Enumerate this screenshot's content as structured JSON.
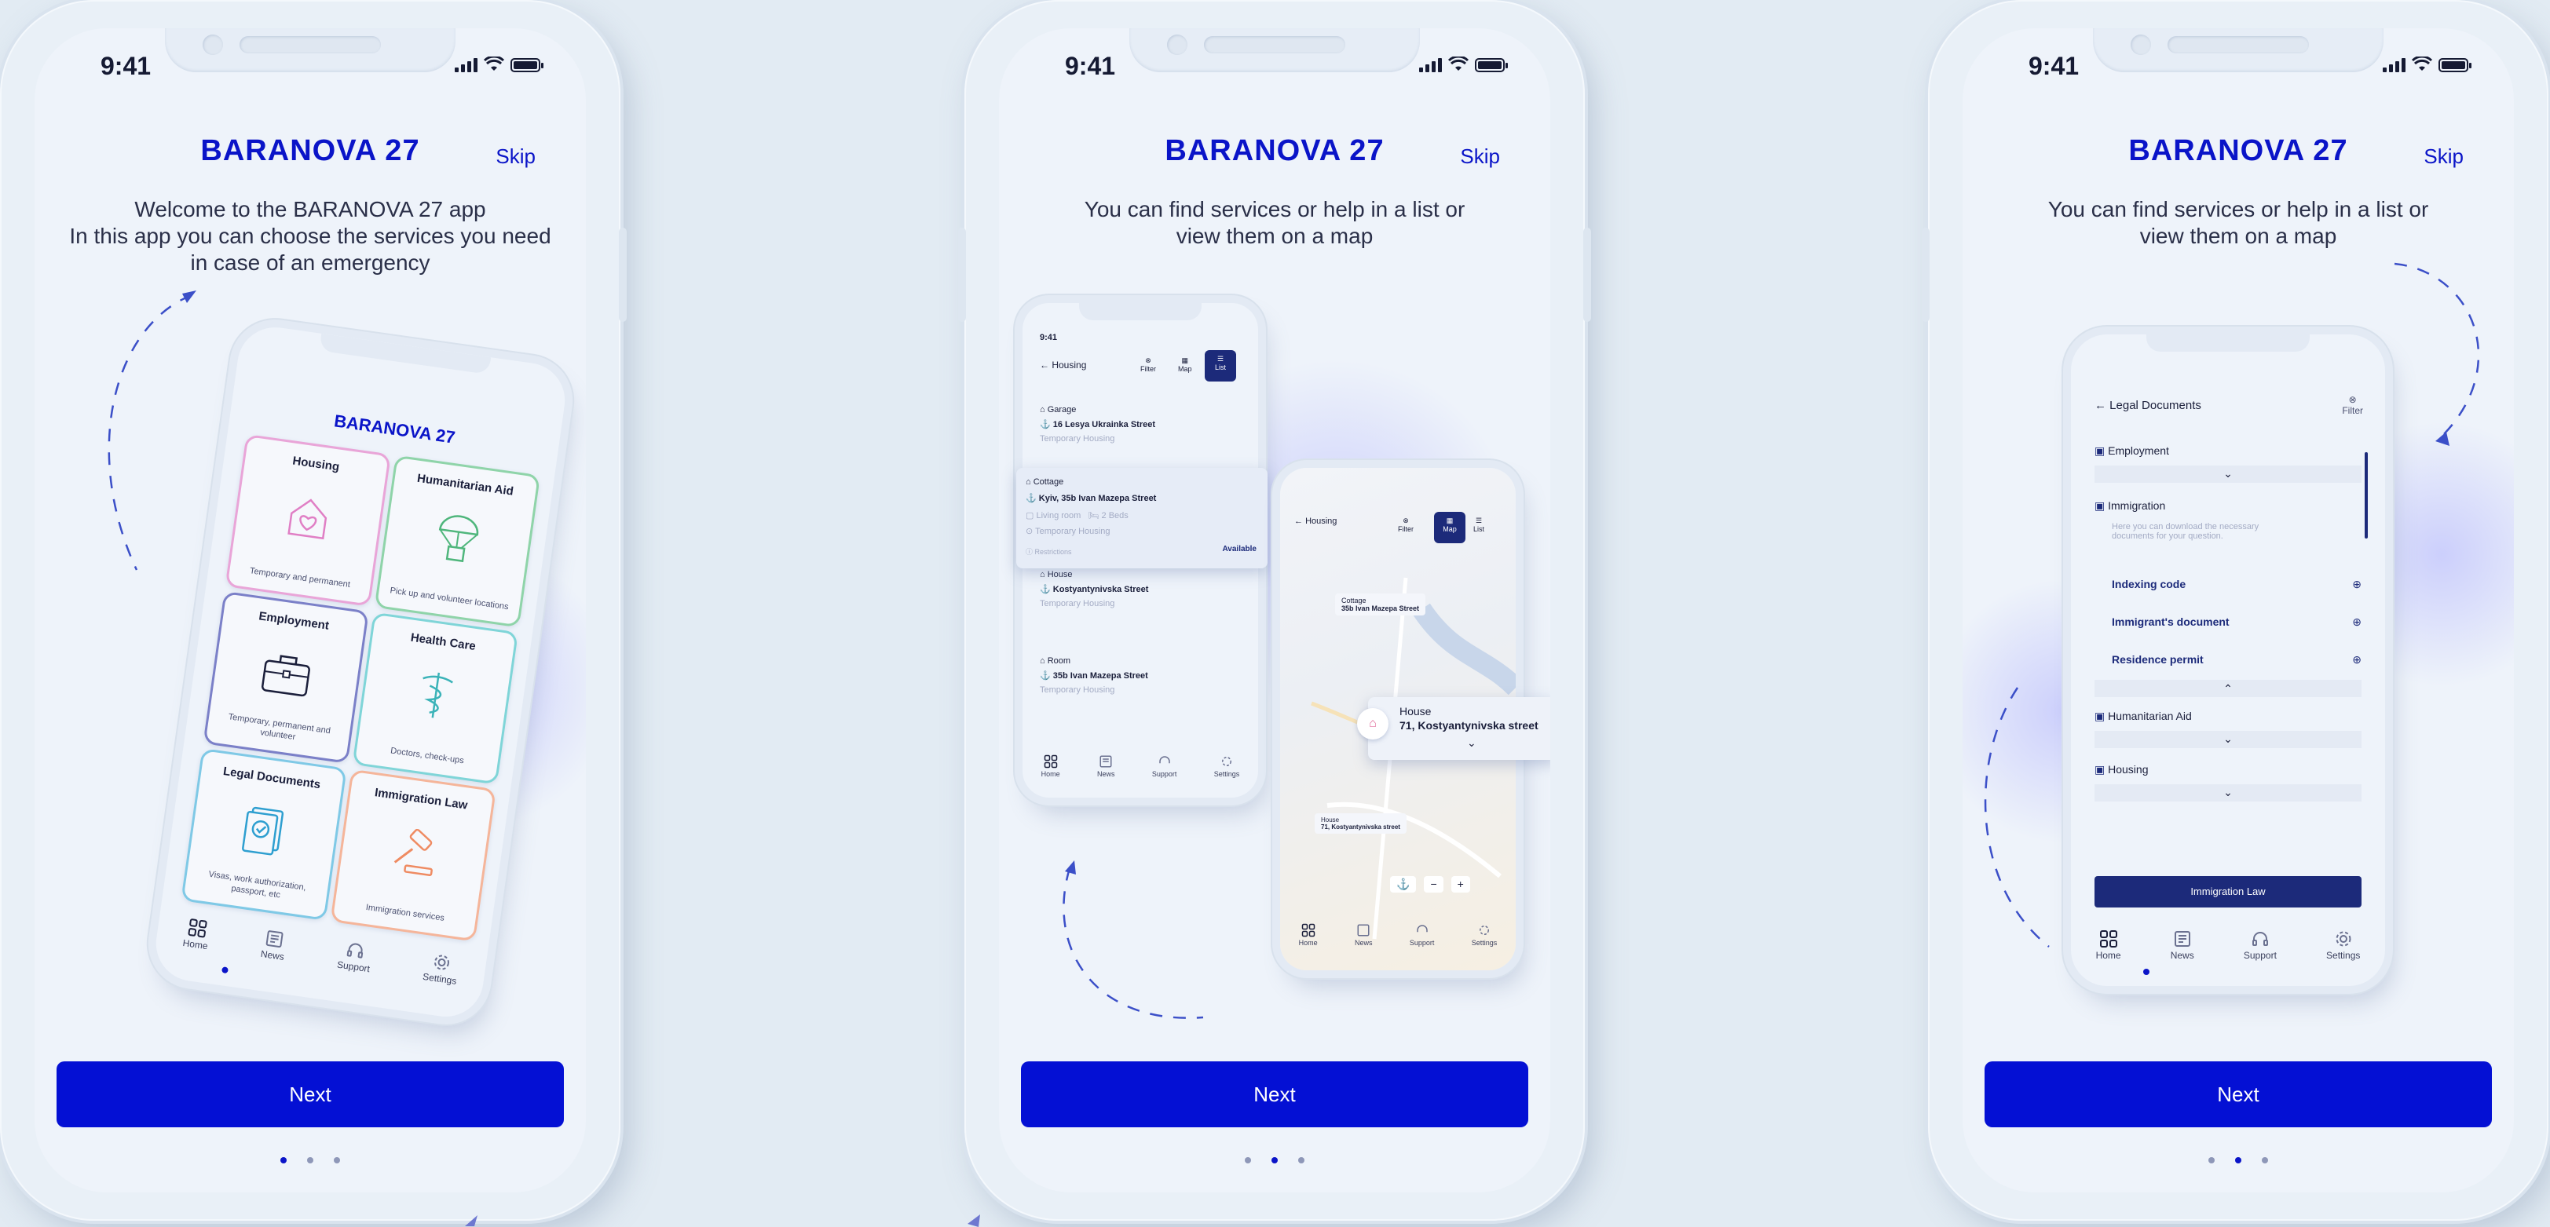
{
  "status": {
    "time": "9:41"
  },
  "screens": [
    {
      "title": "BARANOVA 27",
      "skip": "Skip",
      "desc_lines": [
        "Welcome to the BARANOVA 27 app",
        "In this app you can choose the services you need",
        "in case of an emergency"
      ],
      "next": "Next",
      "mockup": {
        "title": "BARANOVA 27",
        "tiles": [
          {
            "title": "Housing",
            "sub": "Temporary and permanent",
            "icon": "house-heart-icon",
            "color": "#e9a5d8"
          },
          {
            "title": "Humanitarian Aid",
            "sub": "Pick up and volunteer locations",
            "icon": "parachute-box-icon",
            "color": "#8fd4a9"
          },
          {
            "title": "Employment",
            "sub": "Temporary, permanent and volunteer",
            "icon": "briefcase-icon",
            "color": "#7b80c8"
          },
          {
            "title": "Health Care",
            "sub": "Doctors, check-ups",
            "icon": "caduceus-icon",
            "color": "#7fd5d8"
          },
          {
            "title": "Legal Documents",
            "sub": "Visas, work authorization, passport, etc",
            "icon": "document-check-icon",
            "color": "#7fc9e6"
          },
          {
            "title": "Immigration Law",
            "sub": "Immigration services",
            "icon": "gavel-icon",
            "color": "#f5b59a"
          }
        ],
        "tabs": [
          "Home",
          "News",
          "Support",
          "Settings"
        ]
      }
    },
    {
      "title": "BARANOVA 27",
      "skip": "Skip",
      "desc_lines": [
        "You can find services or help in a list or",
        "view them on a map"
      ],
      "next": "Next",
      "list_mock": {
        "time": "9:41",
        "back": "Housing",
        "filter": "Filter",
        "map": "Map",
        "list": "List",
        "items": [
          {
            "type": "Garage",
            "address": "16 Lesya Ukrainka Street",
            "extra": "Temporary Housing"
          },
          {
            "type": "Cottage",
            "address": "Kyiv, 35b Ivan Mazepa Street",
            "room": "Living room",
            "beds": "2 Beds",
            "extra": "Temporary Housing",
            "restrictions": "Restrictions",
            "status": "Available"
          },
          {
            "type": "House",
            "address": "Kostyantynivska Street",
            "extra": "Temporary Housing"
          },
          {
            "type": "Room",
            "address": "35b Ivan Mazepa Street",
            "extra": "Temporary Housing"
          }
        ],
        "tabs": [
          "Home",
          "News",
          "Support",
          "Settings"
        ]
      },
      "map_mock": {
        "back": "Housing",
        "filter": "Filter",
        "map": "Map",
        "list": "List",
        "pins": [
          {
            "label": "Cottage",
            "address": "35b Ivan Mazepa Street"
          },
          {
            "label": "House",
            "address": "71, Kostyantynivska street"
          },
          {
            "label": "House",
            "address": "71, Kostyantynivska street"
          }
        ],
        "zoom_minus": "−",
        "zoom_plus": "+",
        "tabs": [
          "Home",
          "News",
          "Support",
          "Settings"
        ]
      }
    },
    {
      "title": "BARANOVA 27",
      "skip": "Skip",
      "desc_lines": [
        "You can find services or help in a list or",
        "view them on a map"
      ],
      "next": "Next",
      "docs_mock": {
        "back": "Legal Documents",
        "filter": "Filter",
        "sections": [
          "Employment",
          "Immigration"
        ],
        "note": "Here you can download the necessary documents for your question.",
        "docs": [
          "Indexing code",
          "Immigrant's document",
          "Residence permit"
        ],
        "more_sections": [
          "Humanitarian Aid",
          "Housing"
        ],
        "button": "Immigration Law",
        "tabs": [
          "Home",
          "News",
          "Support",
          "Settings"
        ]
      }
    }
  ],
  "colors": {
    "accent": "#0410d4",
    "title": "#0a14c8",
    "background": "#e2ebf3"
  }
}
